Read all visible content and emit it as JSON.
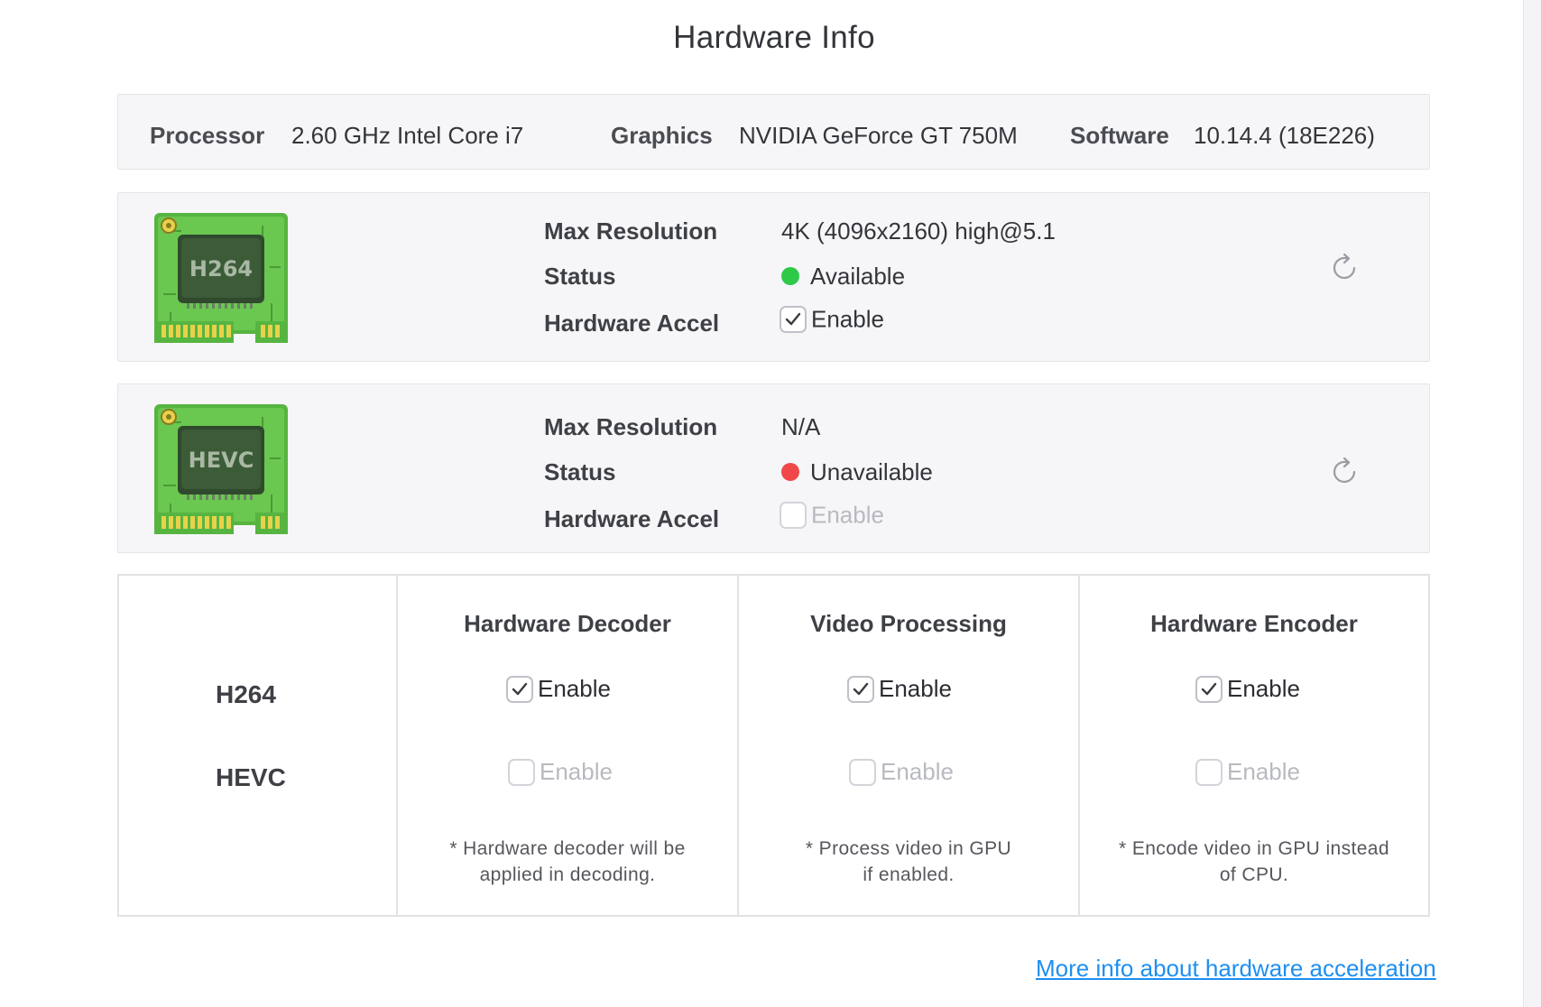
{
  "title": "Hardware Info",
  "system": {
    "processor_label": "Processor",
    "processor_value": "2.60 GHz Intel Core i7",
    "graphics_label": "Graphics",
    "graphics_value": "NVIDIA GeForce GT 750M",
    "software_label": "Software",
    "software_value": "10.14.4 (18E226)"
  },
  "codecs": [
    {
      "name": "H264",
      "max_res_label": "Max Resolution",
      "max_res_value": "4K (4096x2160) high@5.1",
      "status_label": "Status",
      "status_value": "Available",
      "status_color": "#2fc94a",
      "accel_label": "Hardware Accel",
      "accel_option": "Enable",
      "accel_checked": true
    },
    {
      "name": "HEVC",
      "max_res_label": "Max Resolution",
      "max_res_value": "N/A",
      "status_label": "Status",
      "status_value": "Unavailable",
      "status_color": "#f04848",
      "accel_label": "Hardware Accel",
      "accel_option": "Enable",
      "accel_checked": false
    }
  ],
  "matrix": {
    "columns": [
      "Hardware Decoder",
      "Video Processing",
      "Hardware Encoder"
    ],
    "rows": [
      "H264",
      "HEVC"
    ],
    "option": "Enable",
    "notes": [
      [
        "* Hardware decoder will be",
        "applied in decoding."
      ],
      [
        "* Process video in GPU",
        "if enabled."
      ],
      [
        "* Encode video in GPU instead",
        "of CPU."
      ]
    ]
  },
  "link": "More info about hardware acceleration",
  "icons": {
    "refresh": "refresh-icon",
    "check": "checkmark-icon",
    "chip": "chip-icon"
  }
}
